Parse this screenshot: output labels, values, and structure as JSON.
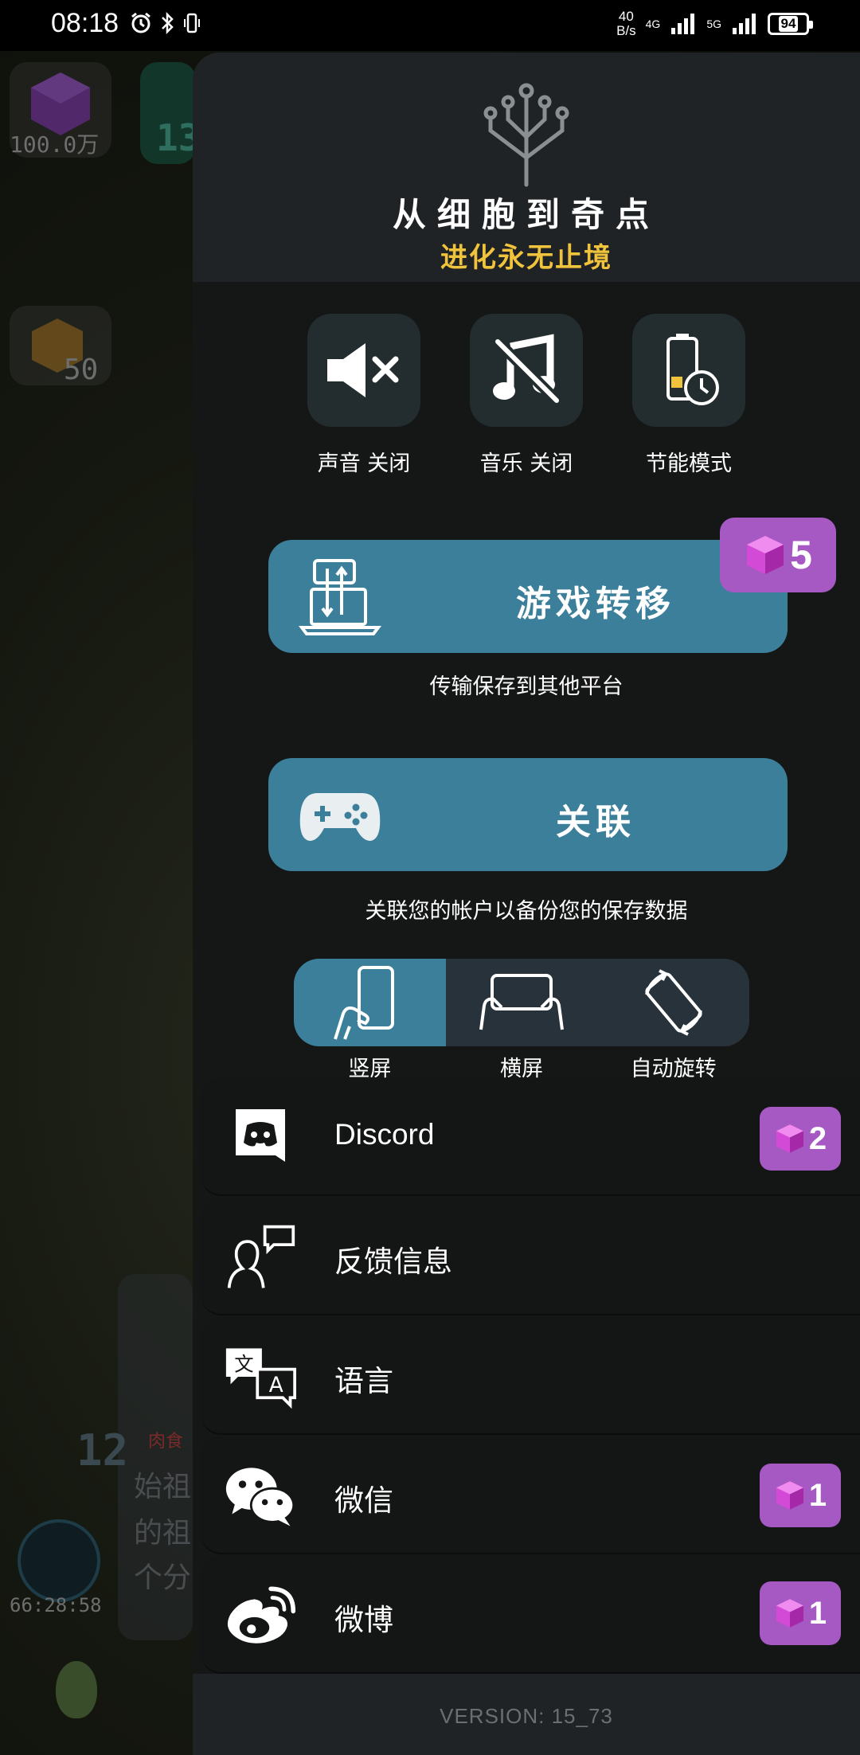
{
  "status_bar": {
    "time": "08:18",
    "speed_top": "40",
    "speed_bottom": "B/s",
    "net1": "4G",
    "net2": "5G",
    "battery": "94"
  },
  "background": {
    "gems_amount": "100.0万",
    "level_top": "13",
    "cube_count": "50",
    "level_bottom": "12",
    "timer": "66:28:58",
    "tag": "肉食",
    "text_line1": "始祖",
    "text_line2": "的祖",
    "text_line3": "个分"
  },
  "header": {
    "title": "从细胞到奇点",
    "subtitle": "进化永无止境"
  },
  "toggles": [
    {
      "label": "声音 关闭",
      "icon": "speaker-muted-icon"
    },
    {
      "label": "音乐 关闭",
      "icon": "music-off-icon"
    },
    {
      "label": "节能模式",
      "icon": "battery-saver-icon"
    }
  ],
  "transfer": {
    "label": "游戏转移",
    "description": "传输保存到其他平台",
    "gem_reward": "5"
  },
  "link": {
    "label": "关联",
    "description": "关联您的帐户以备份您的保存数据"
  },
  "orientation": {
    "options": [
      "竖屏",
      "横屏",
      "自动旋转"
    ],
    "selected": "竖屏"
  },
  "menu": [
    {
      "label": "Discord",
      "icon": "discord-icon",
      "gem_reward": "2"
    },
    {
      "label": "反馈信息",
      "icon": "feedback-icon",
      "gem_reward": ""
    },
    {
      "label": "语言",
      "icon": "language-icon",
      "gem_reward": ""
    },
    {
      "label": "微信",
      "icon": "wechat-icon",
      "gem_reward": "1"
    },
    {
      "label": "微博",
      "icon": "weibo-icon",
      "gem_reward": "1"
    }
  ],
  "version": "VERSION:  15_73",
  "colors": {
    "accent_blue": "#3b7f9b",
    "gem_badge": "#a659c2",
    "subtitle_yellow": "#f0c33c",
    "panel_bg": "#151616"
  }
}
